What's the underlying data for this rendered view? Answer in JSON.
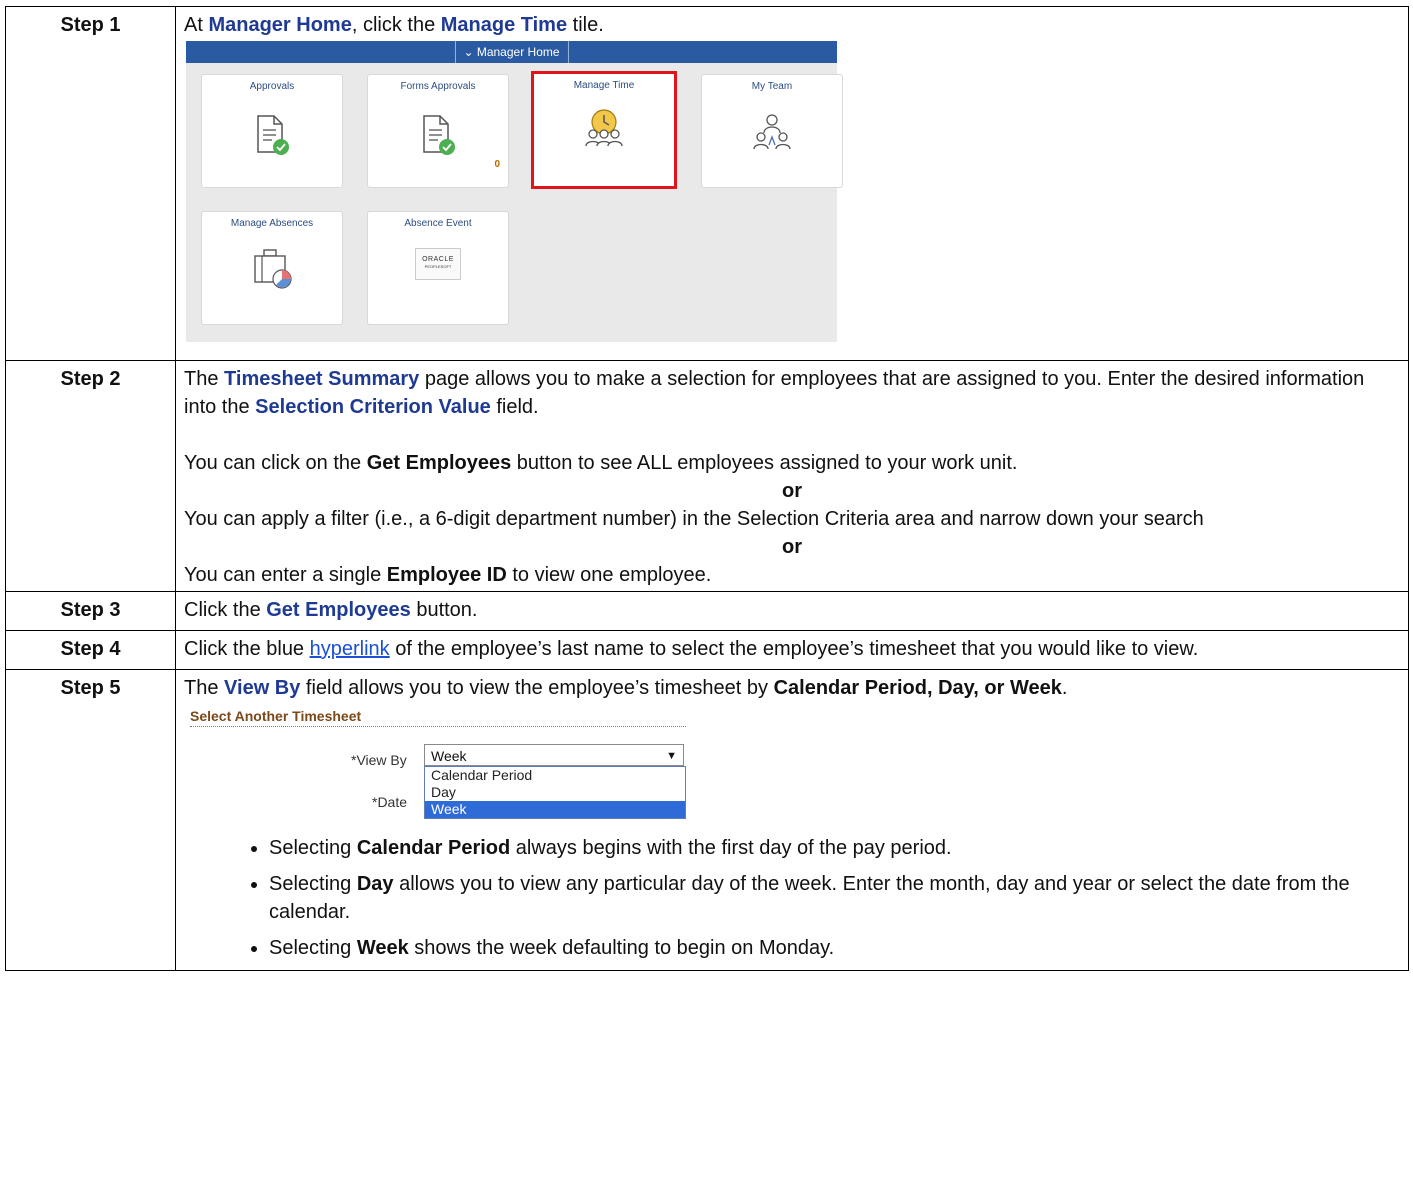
{
  "steps": [
    {
      "label": "Step 1"
    },
    {
      "label": "Step 2"
    },
    {
      "label": "Step 3"
    },
    {
      "label": "Step 4"
    },
    {
      "label": "Step 5"
    }
  ],
  "step1": {
    "pre": "At ",
    "manager_home": "Manager Home",
    "mid": ", click the ",
    "manage_time": "Manage Time",
    "post": " tile.",
    "shot": {
      "bar_title": "⌄ Manager Home",
      "tiles": [
        {
          "title": "Approvals"
        },
        {
          "title": "Forms Approvals",
          "badge": "0"
        },
        {
          "title": "Manage Time"
        },
        {
          "title": "My Team"
        },
        {
          "title": "Manage Absences"
        },
        {
          "title": "Absence Event",
          "logo_top": "ORACLE",
          "logo_bottom": "PEOPLESOFT"
        }
      ]
    }
  },
  "step2": {
    "l1_a": "The ",
    "timesheet_summary": "Timesheet Summary",
    "l1_b": " page allows you to make a selection for employees that are assigned to you. Enter the desired information into the ",
    "selection_value": "Selection Criterion Value",
    "l1_c": " field.",
    "l2_a": "You can click on the ",
    "get_employees": "Get Employees",
    "l2_b": " button to see ALL employees assigned to your work unit.",
    "or": "or",
    "l3": "You can apply a filter (i.e., a 6-digit department number) in the Selection Criteria area and narrow down your search",
    "l4_a": "You can enter a single ",
    "employee_id": "Employee ID",
    "l4_b": " to view one employee."
  },
  "step3": {
    "a": "Click the ",
    "get_employees": "Get Employees",
    "b": " button."
  },
  "step4": {
    "a": "Click the blue ",
    "link": "hyperlink",
    "b": " of the employee’s last name to select the employee’s timesheet that you would like to view."
  },
  "step5": {
    "a": "The ",
    "view_by": "View By",
    "b": " field allows you to view the employee’s timesheet by ",
    "options_bold": "Calendar Period, Day, or Week",
    "c": ".",
    "shot": {
      "title": "Select Another Timesheet",
      "view_by_label": "*View By",
      "date_label": "*Date",
      "selected": "Week",
      "options": [
        "Calendar Period",
        "Day",
        "Week"
      ]
    },
    "bullets": [
      {
        "pre": "Selecting ",
        "bold": "Calendar Period",
        "post": " always begins with the first day of the pay period."
      },
      {
        "pre": "Selecting ",
        "bold": "Day",
        "post": " allows you to view any particular day of the week. Enter the month, day and year or select the date from the calendar."
      },
      {
        "pre": "Selecting ",
        "bold": "Week",
        "post": " shows the week defaulting to begin on Monday."
      }
    ]
  }
}
